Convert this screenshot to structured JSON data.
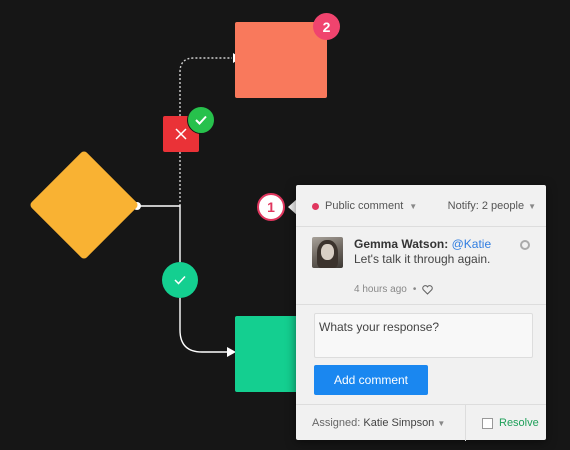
{
  "flow": {
    "badges": {
      "orange_number": "2",
      "panel_number": "1"
    }
  },
  "panel": {
    "visibility": "Public comment",
    "notify": "Notify: 2 people",
    "comment": {
      "author": "Gemma Watson:",
      "mention": "@Katie",
      "text": " Let's talk it through again.",
      "time": "4 hours ago",
      "separator": "•"
    },
    "reply": {
      "placeholder": "Whats your response?"
    },
    "add_button": "Add comment",
    "assigned_label": "Assigned:",
    "assigned_name": "Katie Simpson",
    "resolve_label": "Resolve"
  },
  "colors": {
    "background": "#161616",
    "orange": "#f9795c",
    "green": "#14cf90",
    "yellow": "#f9b233",
    "red": "#ea3237",
    "accent_blue": "#1a87f0",
    "badge_pink": "#f0446e"
  }
}
